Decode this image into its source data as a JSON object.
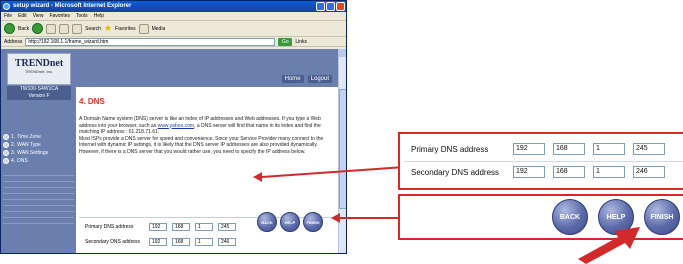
{
  "browser": {
    "title": "setup wizard - Microsoft Internet Explorer",
    "menu": [
      "File",
      "Edit",
      "View",
      "Favorites",
      "Tools",
      "Help"
    ],
    "toolbar": {
      "back": "Back",
      "search": "Search",
      "favorites": "Favorites",
      "media": "Media"
    },
    "address_label": "Address",
    "address_value": "http://192.168.1.1/frame_wizard.htm",
    "go_label": "Go",
    "links_label": "Links"
  },
  "sidebar": {
    "logo": "TRENDnet",
    "logo_sub": "TRENDnet, Inc.",
    "model": "TW100-S4W1CA",
    "version": "Version F",
    "steps": [
      {
        "num": "1.",
        "label": "Time Zone"
      },
      {
        "num": "2.",
        "label": "WAN Type"
      },
      {
        "num": "3.",
        "label": "WAN Settings"
      },
      {
        "num": "4.",
        "label": "DNS"
      }
    ]
  },
  "nav": {
    "home": "Home",
    "logout": "Logout"
  },
  "main": {
    "title": "4. DNS",
    "desc_1": "A Domain Name system (DNS) server is like an index of IP addresses and Web addresses. If you type a Web address into your browser, such as ",
    "desc_link": "www.yahoo.com",
    "desc_2": ", a DNS server will find that name in its index and find the matching IP address : 61.218.71.61.",
    "desc_3": "Most ISPs provide a DNS server for speed and convenience. Since your Service Provider many connect to the Internet with dynamic IP settings, it is likely that the DNS server IP addresses are also provided dynamically. However, if there is a DNS server that you would rather use, you need to specify the IP address below.",
    "primary_label": "Primary DNS address",
    "primary_ip": [
      "192",
      "168",
      "1",
      "245"
    ],
    "secondary_label": "Secondary DNS address",
    "secondary_ip": [
      "192",
      "168",
      "1",
      "246"
    ]
  },
  "buttons": {
    "back": "BACK",
    "help": "HELP",
    "finish": "FINISH"
  },
  "zoom": {
    "primary_label": "Primary DNS address",
    "primary_ip": [
      "192",
      "168",
      "1",
      "245"
    ],
    "secondary_label": "Secondary DNS address",
    "secondary_ip": [
      "192",
      "168",
      "1",
      "246"
    ],
    "back": "BACK",
    "help": "HELP",
    "finish": "FINISH"
  },
  "colors": {
    "accent_red": "#d22a2a",
    "nav_blue": "#6a7fae",
    "title_red": "#d9352a"
  }
}
